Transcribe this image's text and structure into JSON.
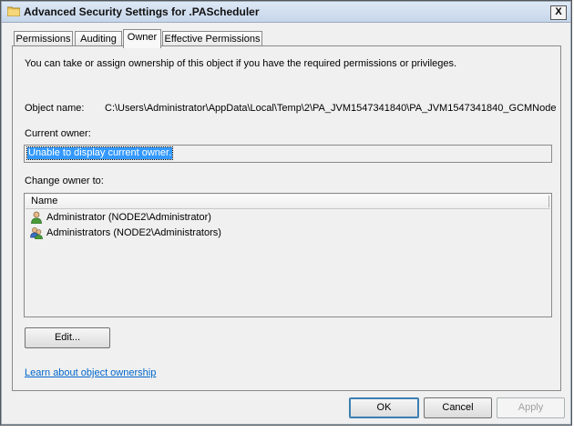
{
  "window": {
    "title": "Advanced Security Settings for .PAScheduler",
    "close_label": "X"
  },
  "tabs": [
    {
      "label": "Permissions",
      "active": false
    },
    {
      "label": "Auditing",
      "active": false
    },
    {
      "label": "Owner",
      "active": true
    },
    {
      "label": "Effective Permissions",
      "active": false
    }
  ],
  "owner_tab": {
    "intro": "You can take or assign ownership of this object if you have the required permissions or privileges.",
    "object_name_label": "Object name:",
    "object_name_value": "C:\\Users\\Administrator\\AppData\\Local\\Temp\\2\\PA_JVM1547341840\\PA_JVM1547341840_GCMNode",
    "current_owner_label": "Current owner:",
    "current_owner_value": "Unable to display current owner.",
    "change_owner_label": "Change owner to:",
    "list_header": "Name",
    "owners": [
      {
        "name": "Administrator (NODE2\\Administrator)",
        "icon": "user-icon"
      },
      {
        "name": "Administrators (NODE2\\Administrators)",
        "icon": "user-group-icon"
      }
    ],
    "edit_button": "Edit...",
    "learn_link": "Learn about object ownership"
  },
  "footer": {
    "ok": "OK",
    "cancel": "Cancel",
    "apply": "Apply"
  }
}
